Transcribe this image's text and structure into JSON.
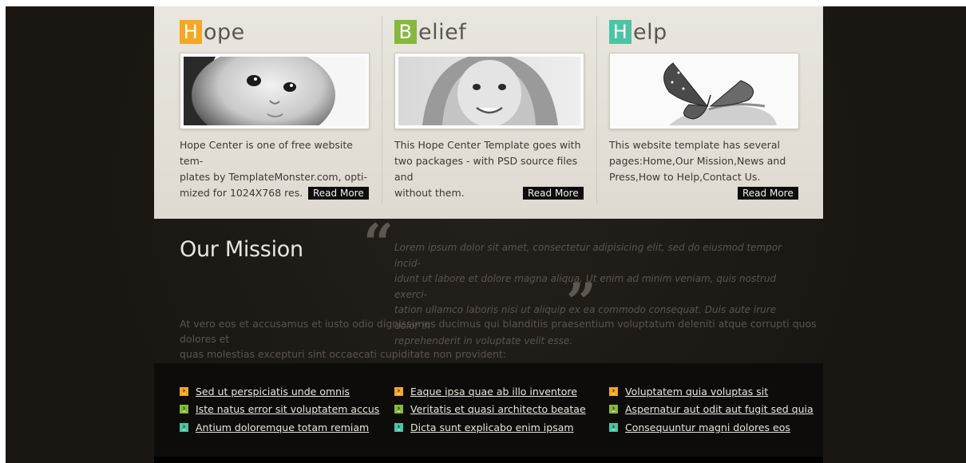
{
  "columns": [
    {
      "letter": "H",
      "rest": "ope",
      "color": "#f5a623",
      "image_icon": "baby-face-photo",
      "text": "Hope Center is one of free website tem-plates by TemplateMonster.com, opti-mized for 1024X768 res.",
      "text_lines": [
        "Hope Center is one of free website tem-",
        "plates by TemplateMonster.com, opti-",
        "mized for 1024X768 res."
      ],
      "read_more": "Read More"
    },
    {
      "letter": "B",
      "rest": "elief",
      "color": "#86b83c",
      "image_icon": "child-hood-photo",
      "text_lines": [
        "This Hope Center Template goes with",
        "two packages - with PSD source files and",
        "without them."
      ],
      "read_more": "Read More"
    },
    {
      "letter": "H",
      "rest": "elp",
      "color": "#4cc4a4",
      "image_icon": "butterfly-photo",
      "text_lines": [
        "This website template has several",
        "pages:Home,Our Mission,News and",
        "Press,How to Help,Contact Us."
      ],
      "read_more": "Read More"
    }
  ],
  "mission": {
    "title": "Our Mission",
    "quote_lines": [
      "Lorem ipsum dolor sit amet, consectetur adipisicing elit, sed do eiusmod tempor incid-",
      "idunt ut labore et dolore magna aliqua. Ut enim ad minim veniam, quis nostrud exerci-",
      "tation ullamco laboris nisi ut aliquip ex ea commodo consequat. Duis aute irure dolor in",
      "reprehenderit in voluptate velit esse."
    ],
    "body_lines": [
      "At vero eos et accusamus et iusto odio dignissimos ducimus qui blanditiis praesentium voluptatum deleniti atque corrupti quos dolores et",
      "quas molestias excepturi sint occaecati cupiditate non provident:"
    ]
  },
  "links": [
    [
      "Sed ut perspiciatis unde omnis",
      "Iste natus error sit voluptatem accus",
      "Antium doloremque totam remiam"
    ],
    [
      "Eaque ipsa quae ab illo inventore",
      "Veritatis et quasi architecto beatae",
      "Dicta sunt explicabo enim ipsam"
    ],
    [
      "Voluptatem quia voluptas sit",
      "Aspernatur aut odit aut fugit sed quia",
      "Consequuntur magni dolores eos"
    ]
  ],
  "bullet_colors": [
    "#f5a623",
    "#86b83c",
    "#4cc4a4"
  ]
}
